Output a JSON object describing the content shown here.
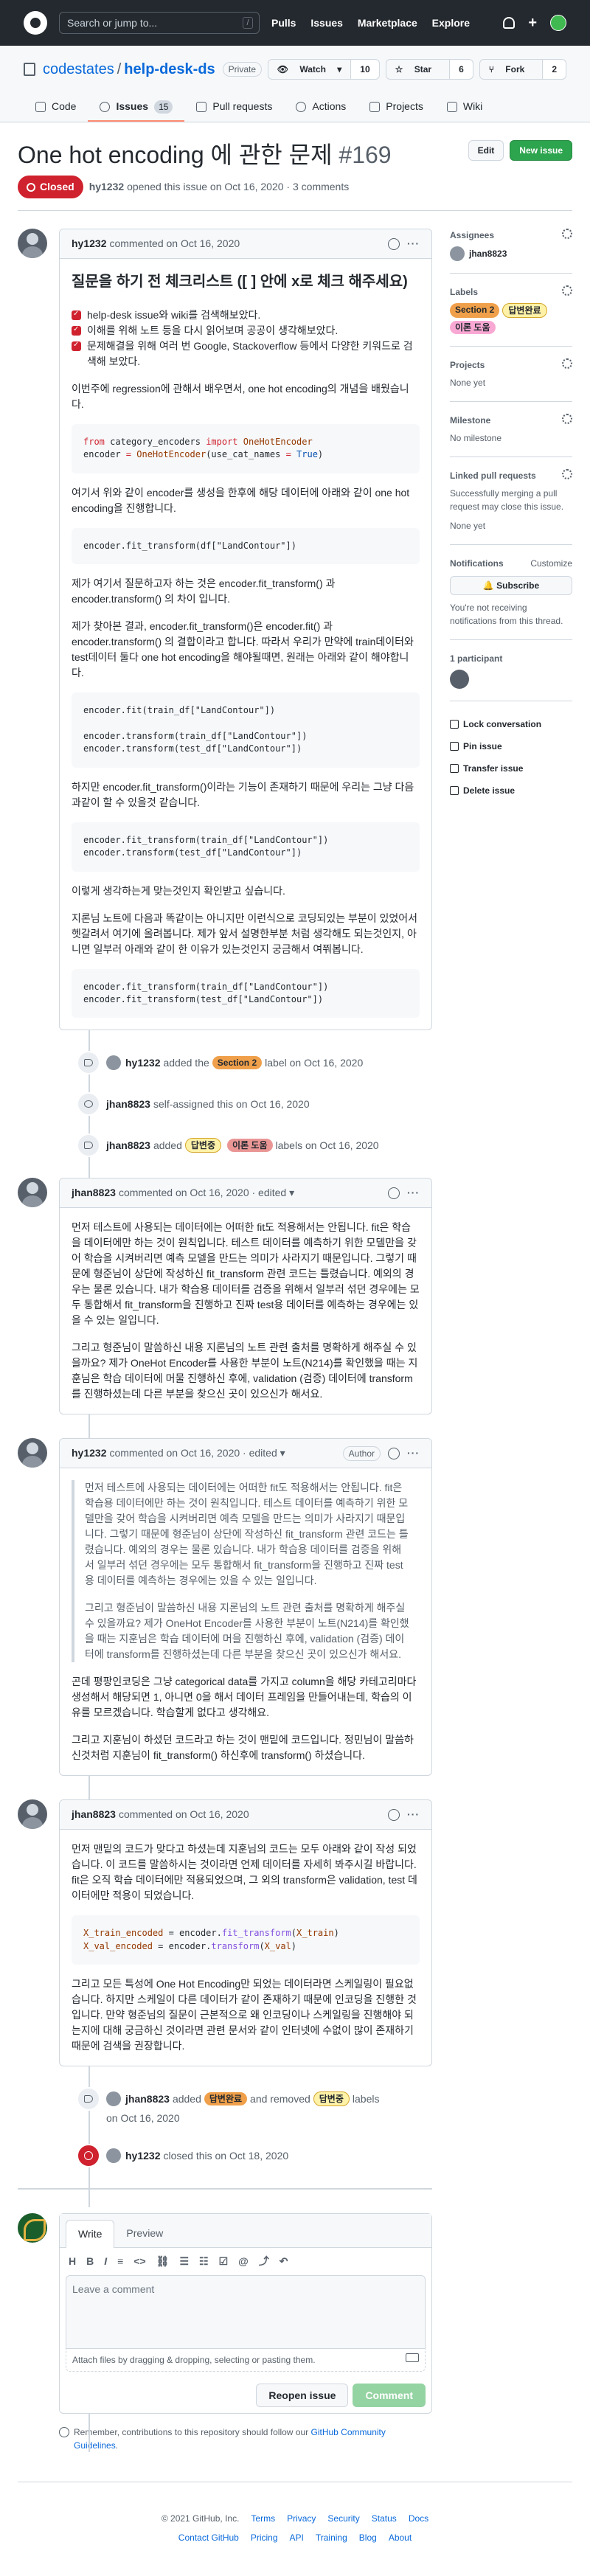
{
  "header": {
    "search_placeholder": "Search or jump to...",
    "search_key": "/",
    "nav": [
      "Pulls",
      "Issues",
      "Marketplace",
      "Explore"
    ],
    "plus": "+"
  },
  "repo": {
    "owner": "codestates",
    "sep": "/",
    "name": "help-desk-ds",
    "visibility": "Private",
    "watch_label": "Watch",
    "watch_count": "10",
    "star_label": "Star",
    "star_count": "6",
    "fork_label": "Fork",
    "fork_count": "2",
    "tabs": [
      {
        "label": "Code"
      },
      {
        "label": "Issues",
        "count": "15"
      },
      {
        "label": "Pull requests"
      },
      {
        "label": "Actions"
      },
      {
        "label": "Projects"
      },
      {
        "label": "Wiki"
      }
    ]
  },
  "issue": {
    "title": "One hot encoding 에 관한 문제",
    "number": "#169",
    "edit_label": "Edit",
    "new_issue_label": "New issue",
    "state": "Closed",
    "author": "hy1232",
    "meta": "opened this issue on Oct 16, 2020 · 3 comments"
  },
  "comments": [
    {
      "author": "hy1232",
      "meta": "commented on Oct 16, 2020",
      "heading": "질문을 하기 전 체크리스트 ([ ] 안에 x로 체크 해주세요)",
      "checks": [
        "help-desk issue와 wiki를 검색해보았다.",
        "이해를 위해 노트 등을 다시 읽어보며 공공이 생각해보았다.",
        "문제해결을 위해 여러 번 Google, Stackoverflow 등에서 다양한 키워드로 검색해 보았다."
      ],
      "p1": "이번주에 regression에 관해서 배우면서, one hot encoding의 개념을 배웠습니다.",
      "code1_kw1": "from",
      "code1_mod": " category_encoders ",
      "code1_kw2": "import",
      "code1_cls": " OneHotEncoder",
      "code1_line2a": "encoder ",
      "code1_line2b": "=",
      "code1_line2c": " OneHotEncoder",
      "code1_line2d": "(use_cat_names ",
      "code1_line2e": "=",
      "code1_line2f": " True",
      "code1_line2g": ")",
      "p2": "여기서 위와 같이 encoder를 생성을 한후에 해당 데이터에 아래와 같이 one hot encoding을 진행합니다.",
      "code2": "encoder.fit_transform(df[\"LandContour\"])",
      "p3": "제가 여기서 질문하고자 하는 것은 encoder.fit_transform() 과 encoder.transform() 의 차이 입니다.",
      "p4": "제가 찾아본 결과, encoder.fit_transform()은 encoder.fit() 과 encoder.transform() 의 결합이라고 합니다. 따라서 우리가 만약에 train데이터와 test데이터 둘다 one hot encoding을 해야될때면, 원래는 아래와 같이 해야합니다.",
      "code3": "encoder.fit(train_df[\"LandContour\"])\n\nencoder.transform(train_df[\"LandContour\"])\nencoder.transform(test_df[\"LandContour\"])",
      "p5": "하지만 encoder.fit_transform()이라는 기능이 존재하기 때문에 우리는 그냥 다음과같이 할 수 있을것 같습니다.",
      "code4": "encoder.fit_transform(train_df[\"LandContour\"])\nencoder.transform(test_df[\"LandContour\"])",
      "p6": "이렇게 생각하는게 맞는것인지 확인받고 싶습니다.",
      "p7": "지론님 노트에 다음과 똑같이는 아니지만 이런식으로 코딩되있는 부분이 있었어서 헷갈려서 여기에 올려봅니다. 제가 앞서 설명한부분 처럼 생각해도 되는것인지, 아니면 일부러 아래와 같이 한 이유가 있는것인지 궁금해서 여쭤봅니다.",
      "code5": "encoder.fit_transform(train_df[\"LandContour\"])\nencoder.fit_transform(test_df[\"LandContour\"])"
    },
    {
      "author": "jhan8823",
      "meta": "commented on Oct 16, 2020 · edited",
      "p1": "먼저 테스트에 사용되는 데이터에는 어떠한 fit도 적용해서는 안됩니다. fit은 학습을 데이터에만 하는 것이 원칙입니다. 테스트 데이터를 예측하기 위한 모델만을 갖어 학습을 시켜버리면 예측 모델을 만드는 의미가 사라지기 때문입니다. 그렇기 때문에 형준님이 상단에 작성하신 fit_transform 관련 코드는 틀렸습니다. 예외의 경우는 물론 있습니다. 내가 학습용 데이터를 검증을 위해서 일부러 섞던 경우에는 모두 통합해서 fit_transform을 진행하고 진짜 test용 데이터를 예측하는 경우에는 있을 수 있는 일입니다.",
      "p2": "그리고 형준님이 말씀하신 내용 지론님의 노트 관련 출처를 명확하게 해주실 수 있을까요? 제가 OneHot Encoder를 사용한 부분이 노트(N214)를 확인했을 때는 지훈님은 학습 데이터에 머물 진행하신 후에, validation (검증) 데이터에 transform를 진행하셨는데 다른 부분을 찾으신 곳이 있으신가 해서요."
    },
    {
      "author": "hy1232",
      "meta": "commented on Oct 16, 2020 · edited",
      "tag": "Author",
      "q1": "먼저 테스트에 사용되는 데이터에는 어떠한 fit도 적용해서는 안됩니다. fit은 학습용 데이터에만 하는 것이 원칙입니다. 테스트 데이터를 예측하기 위한 모델만을 갖어 학습을 시켜버리면 예측 모델을 만드는 의미가 사라지기 때문입니다. 그렇기 때문에 형준님이 상단에 작성하신 fit_transform 관련 코드는 틀렸습니다. 예외의 경우는 물론 있습니다. 내가 학습용 데이터를 검증을 위해서 일부러 섞던 경우에는 모두 통합해서 fit_transform을 진행하고 진짜 test용 데이터를 예측하는 경우에는 있을 수 있는 일입니다.",
      "q2": "그리고 형준님이 말씀하신 내용 지론님의 노트 관련 출처를 명확하게 해주실 수 있을까요? 제가 OneHot Encoder를 사용한 부분이 노트(N214)를 확인했을 때는 지훈님은 학습 데이터에 머을 진행하신 후에, validation (검증) 데이터에 transform를 진행하셨는데 다른 부분을 찾으신 곳이 있으신가 해서요.",
      "p1": "곤데 평팡인코딩은 그냥 categorical data를 가지고 column을 해당 카테고리마다 생성해서 해당되면 1, 아니면 0을 해서 데이터 프레임을 만들어내는데, 학습의 이유를 모르겠습니다. 학습할게 없다고 생각해요.",
      "p2": "그리고 지훈님이 하셨던 코드라고 하는 것이 맨밑에 코드입니다. 정민님이 말씀하신것처럼 지훈님이 fit_transform() 하신후에 transform() 하셨습니다."
    },
    {
      "author": "jhan8823",
      "meta": "commented on Oct 16, 2020",
      "p1": "먼저 맨밑의 코드가 맞다고 하셨는데 지훈님의 코드는 모두 아래와 같이 작성 되었습니다. 이 코드를 말씀하시는 것이라면 언제 데이터를 자세히 봐주시길 바랍니다. fit은 오직 학습 데이터에만 적용되었으며, 그 외의 transform은 validation, test 데이터에만 적용이 되었습니다.",
      "code_a": "X_train_encoded",
      "code_b": " = encoder.",
      "code_c": "fit_transform",
      "code_d": "(",
      "code_e": "X_train",
      "code_f": ")",
      "code_g": "X_val_encoded",
      "code_h": " = encoder.",
      "code_i": "transform",
      "code_j": "(",
      "code_k": "X_val",
      "code_l": ")",
      "p2": "그리고 모든 특성에 One Hot Encoding만 되었는 데이터라면 스케일링이 필요없습니다. 하지만 스케일이 다른 데이터가 같이 존재하기 때문에 인코딩을 진행한 것입니다. 만약 형준님의 질문이 근본적으로 왜 인코딩이나 스케일링을 진행해야 되는지에 대해 궁금하신 것이라면 관련 문서와 같이 인터넷에 수없이 많이 존재하기 때문에 검색을 권장합니다."
    }
  ],
  "events": {
    "e1_user": "hy1232",
    "e1_pre": "added the",
    "e1_label": "Section 2",
    "e1_post": "label on Oct 16, 2020",
    "e2_user": "jhan8823",
    "e2_text": "self-assigned this on Oct 16, 2020",
    "e3_user": "jhan8823",
    "e3_pre": "added",
    "e3_label1": "답변중",
    "e3_label2": "이론 도움",
    "e3_post": "labels on Oct 16, 2020",
    "e4_user": "jhan8823",
    "e4_pre": "added",
    "e4_label1": "답변완료",
    "e4_mid": "and removed",
    "e4_label2": "답변중",
    "e4_post": "labels",
    "e4_date": "on Oct 16, 2020",
    "e5_user": "hy1232",
    "e5_text": "closed this on Oct 18, 2020"
  },
  "editor": {
    "tab_write": "Write",
    "tab_preview": "Preview",
    "tools": [
      "H",
      "B",
      "I",
      "≡",
      "<>",
      "⛓",
      "☰",
      "☷",
      "☑",
      "@",
      "⤴",
      "↶"
    ],
    "placeholder": "Leave a comment",
    "attach_hint": "Attach files by dragging & dropping, selecting or pasting them.",
    "reopen_label": "Reopen issue",
    "comment_label": "Comment",
    "remember_pre": "Remember, contributions to this repository should follow our",
    "remember_link": "GitHub Community Guidelines",
    "remember_post": "."
  },
  "sidebar": {
    "assignees_title": "Assignees",
    "assignee": "jhan8823",
    "labels_title": "Labels",
    "labels": [
      "Section 2",
      "답변완료",
      "이론 도움"
    ],
    "projects_title": "Projects",
    "projects_value": "None yet",
    "milestone_title": "Milestone",
    "milestone_value": "No milestone",
    "linked_title": "Linked pull requests",
    "linked_desc": "Successfully merging a pull request may close this issue.",
    "linked_value": "None yet",
    "notif_title": "Notifications",
    "notif_customize": "Customize",
    "subscribe_label": "Subscribe",
    "notif_desc": "You're not receiving notifications from this thread.",
    "participants": "1 participant",
    "links": [
      "Lock conversation",
      "Pin issue",
      "Transfer issue",
      "Delete issue"
    ]
  },
  "footer": {
    "copy": "© 2021 GitHub, Inc.",
    "row1": [
      "Terms",
      "Privacy",
      "Security",
      "Status",
      "Docs"
    ],
    "row2": [
      "Contact GitHub",
      "Pricing",
      "API",
      "Training",
      "Blog",
      "About"
    ]
  }
}
